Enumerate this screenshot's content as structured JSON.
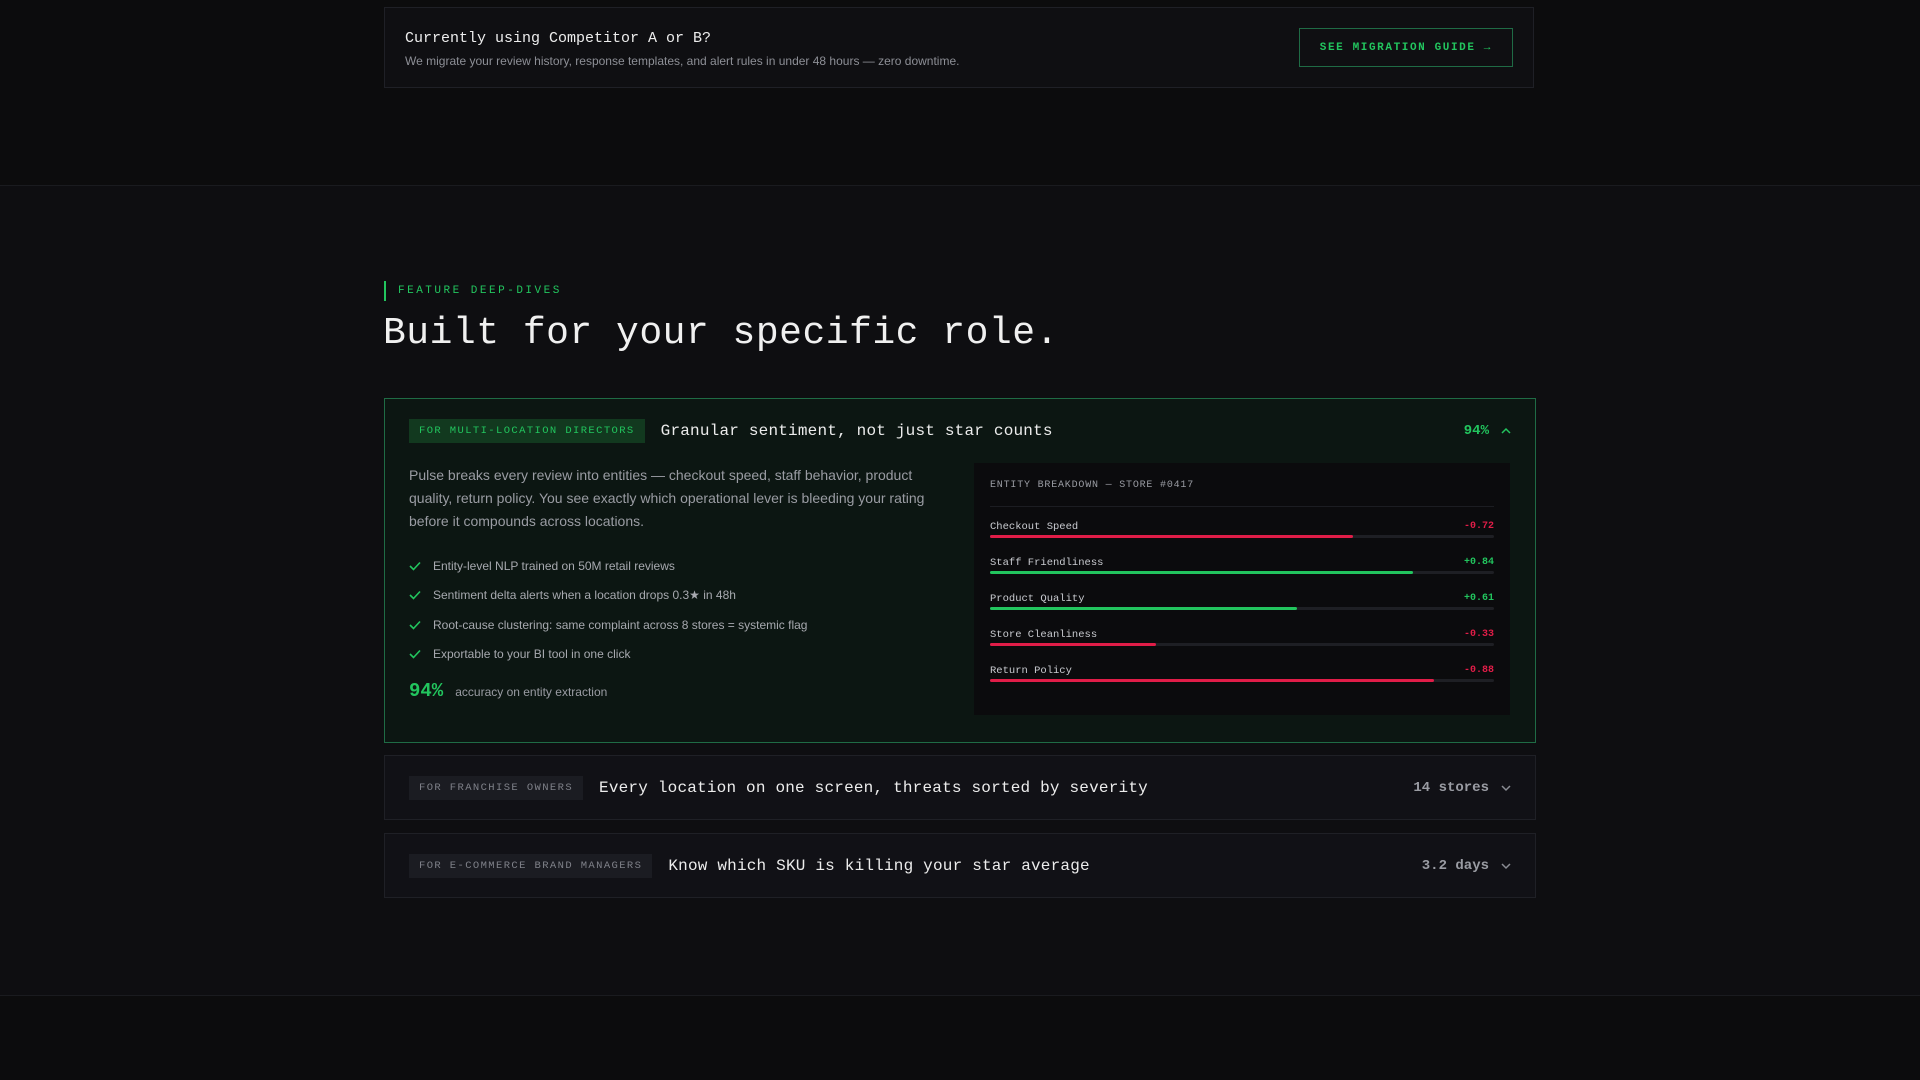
{
  "migration": {
    "title": "Currently using Competitor A or B?",
    "description": "We migrate your review history, response templates, and alert rules in under 48 hours — zero downtime.",
    "button": "SEE MIGRATION GUIDE →"
  },
  "section": {
    "eyebrow": "FEATURE DEEP-DIVES",
    "heading": "Built for your specific role."
  },
  "cards": [
    {
      "tag": "FOR MULTI-LOCATION DIRECTORS",
      "title": "Granular sentiment, not just star counts",
      "metric": "94%",
      "expanded": true,
      "description": "Pulse breaks every review into entities — checkout speed, staff behavior, product quality, return policy. You see exactly which operational lever is bleeding your rating before it compounds across locations.",
      "features": [
        "Entity-level NLP trained on 50M retail reviews",
        "Sentiment delta alerts when a location drops 0.3★ in 48h",
        "Root-cause clustering: same complaint across 8 stores = systemic flag",
        "Exportable to your BI tool in one click"
      ],
      "stat_value": "94%",
      "stat_label": "accuracy on entity extraction",
      "panel": {
        "title": "ENTITY BREAKDOWN — STORE #0417",
        "entities": [
          {
            "name": "Checkout Speed",
            "value": "-0.72",
            "score": -0.72
          },
          {
            "name": "Staff Friendliness",
            "value": "+0.84",
            "score": 0.84
          },
          {
            "name": "Product Quality",
            "value": "+0.61",
            "score": 0.61
          },
          {
            "name": "Store Cleanliness",
            "value": "-0.33",
            "score": -0.33
          },
          {
            "name": "Return Policy",
            "value": "-0.88",
            "score": -0.88
          }
        ]
      }
    },
    {
      "tag": "FOR FRANCHISE OWNERS",
      "title": "Every location on one screen, threats sorted by severity",
      "metric": "14 stores",
      "expanded": false
    },
    {
      "tag": "FOR E-COMMERCE BRAND MANAGERS",
      "title": "Know which SKU is killing your star average",
      "metric": "3.2 days",
      "expanded": false
    }
  ],
  "colors": {
    "accent": "#22c55e",
    "positive": "#22c55e",
    "negative": "#e11d48",
    "background": "#0c0c0d"
  },
  "icons": [
    "check-icon",
    "chevron-up-icon",
    "chevron-down-icon"
  ]
}
